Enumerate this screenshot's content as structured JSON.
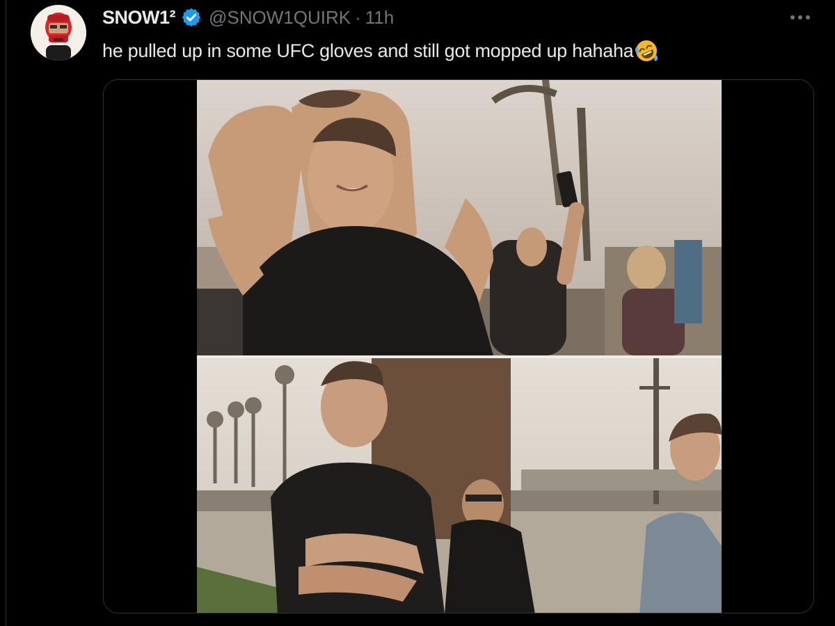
{
  "tweet": {
    "display_name": "SNOW1²",
    "handle": "@SNOW1QUIRK",
    "separator": "·",
    "time": "11h",
    "text": "he pulled up in some UFC gloves and still got mopped up hahaha",
    "emoji": "rolling-on-floor-laughing",
    "verified": true
  },
  "icons": {
    "avatar": "red-helmet-avatar",
    "verified": "verified-badge-icon",
    "more": "more-options-icon"
  },
  "colors": {
    "background": "#000000",
    "text": "#e7e9ea",
    "muted": "#71767b",
    "verified": "#1d9bf0",
    "border": "#2f3336"
  }
}
